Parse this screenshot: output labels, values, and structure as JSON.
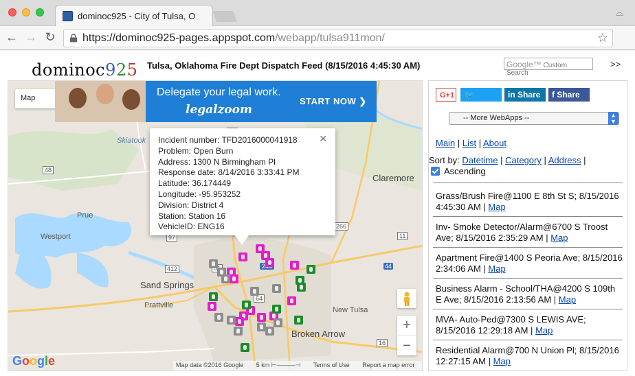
{
  "browser": {
    "tab_title": "dominoc925 - City of Tulsa, O",
    "url_host": "https://dominoc925-pages.appspot.com",
    "url_path": "/webapp/tulsa911mon/"
  },
  "header": {
    "logo_text": "dominoc",
    "logo_9": "9",
    "logo_2": "2",
    "logo_5": "5",
    "title": "Tulsa, Oklahoma Fire Dept Dispatch Feed (8/15/2016 4:45:30 AM)",
    "search_placeholder_brand": "Google™",
    "search_placeholder": "Custom Search",
    "more": ">>"
  },
  "map": {
    "map_type": "Map",
    "ad": {
      "headline": "Delegate your legal work.",
      "brand": "legalzoom",
      "cta": "START NOW ❯",
      "close": "▷ ✕"
    },
    "labels": {
      "skiatook": "Skiatook",
      "claremore": "Claremore",
      "prue": "Prue",
      "westport": "Westport",
      "sand_springs": "Sand Springs",
      "prattville": "Prattville",
      "broken_arrow": "Broken Arrow",
      "new_tulsa": "New Tulsa",
      "r244": "244",
      "r64": "64",
      "r169": "169",
      "r266": "266",
      "r20": "20",
      "r11": "11",
      "r75": "75",
      "r412": "412",
      "r44": "44",
      "r51": "51",
      "r48": "48",
      "r97": "97",
      "r16": "16"
    },
    "info": {
      "incident": "Incident number: TFD2016000041918",
      "problem": "Problem: Open Burn",
      "address": "Address: 1300 N Birmingham Pl",
      "response": "Response date: 8/14/2016 3:33:41 PM",
      "latitude": "Latitude: 36.174449",
      "longitude": "Longitude: -95.953252",
      "division": "Division: District 4",
      "station": "Station: Station 16",
      "vehicle": "VehicleID: ENG16",
      "close": "✕"
    },
    "zoom_in": "+",
    "zoom_out": "−",
    "google_g": "G",
    "google_o1": "o",
    "google_o2": "o",
    "google_g2": "g",
    "google_l": "l",
    "google_e": "e",
    "attribution": {
      "data": "Map data ©2016 Google",
      "scale": "5 km ⊢———⊣",
      "terms": "Terms of Use",
      "report": "Report a map error"
    },
    "colors": {
      "fire": "#e01fc9",
      "medic": "#1c8a2a",
      "alarm": "#8c8c8c",
      "water": "#aadaff",
      "highway": "#f8c967"
    }
  },
  "sidebar": {
    "share": {
      "gplus": "G+1",
      "tweet": "🐦 Tweet",
      "linkedin": "in Share",
      "facebook": "f Share"
    },
    "webapps": "-- More WebApps --",
    "nav": {
      "main": "Main",
      "list": "List",
      "about": "About",
      "sep": "|"
    },
    "sort": {
      "label": "Sort by:",
      "datetime": "Datetime",
      "category": "Category",
      "address": "Address",
      "sep": "|",
      "ascending": "Ascending"
    },
    "items": [
      {
        "text": "Grass/Brush Fire@1100 E 8th St S; 8/15/2016 4:45:30 AM |",
        "link": "Map"
      },
      {
        "text": "Inv- Smoke Detector/Alarm@6700 S Troost Ave; 8/15/2016 2:35:29 AM |",
        "link": "Map"
      },
      {
        "text": "Apartment Fire@1400 S Peoria Ave; 8/15/2016 2:34:06 AM |",
        "link": "Map"
      },
      {
        "text": "Business Alarm - School/THA@4200 S 109th E Ave; 8/15/2016 2:13:56 AM |",
        "link": "Map"
      },
      {
        "text": "MVA- Auto-Ped@7300 S LEWIS AVE; 8/15/2016 12:29:18 AM |",
        "link": "Map"
      },
      {
        "text": "Residential Alarm@700 N Union Pl; 8/15/2016 12:27:15 AM |",
        "link": "Map"
      }
    ]
  }
}
